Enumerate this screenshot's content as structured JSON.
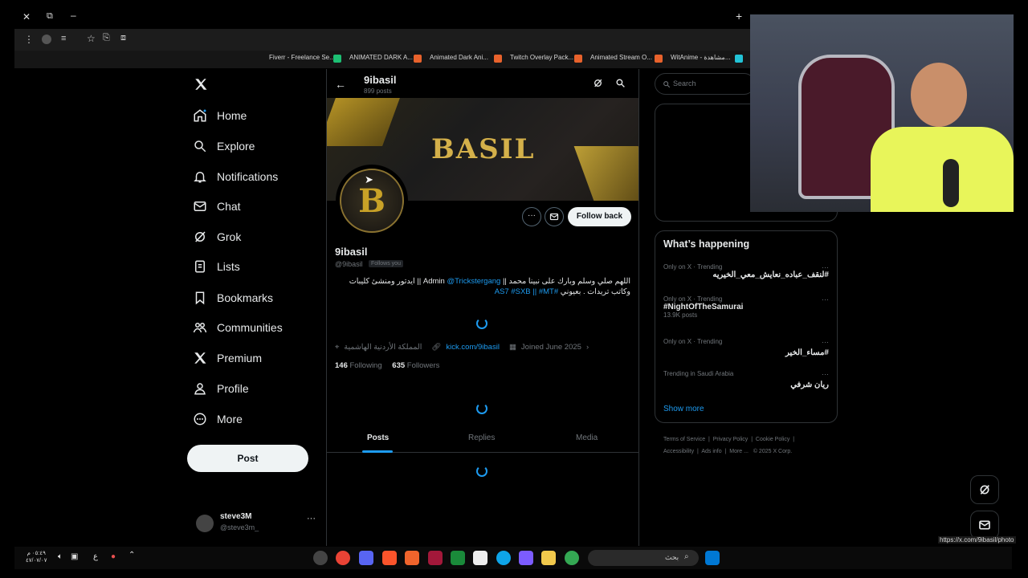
{
  "browser": {
    "bookmarks": [
      {
        "label": "Fiverr - Freelance Se...",
        "color": "#1dbf73"
      },
      {
        "label": "ANIMATED DARK A...",
        "color": "#e8622c"
      },
      {
        "label": "Animated Dark Ani...",
        "color": "#e8622c"
      },
      {
        "label": "Twitch Overlay Pack...",
        "color": "#e8622c"
      },
      {
        "label": "Animated Stream O...",
        "color": "#e8622c"
      },
      {
        "label": "WitAnime - مشاهدة...",
        "color": "#22c3d6"
      }
    ],
    "status_url": "https://x.com/9ibasil/photo"
  },
  "sidebar": {
    "items": [
      {
        "label": "Home",
        "icon": "home-icon"
      },
      {
        "label": "Explore",
        "icon": "search-icon"
      },
      {
        "label": "Notifications",
        "icon": "bell-icon"
      },
      {
        "label": "Chat",
        "icon": "mail-icon"
      },
      {
        "label": "Grok",
        "icon": "grok-icon"
      },
      {
        "label": "Lists",
        "icon": "list-icon"
      },
      {
        "label": "Bookmarks",
        "icon": "bookmark-icon"
      },
      {
        "label": "Communities",
        "icon": "people-icon"
      },
      {
        "label": "Premium",
        "icon": "x-logo-icon"
      },
      {
        "label": "Profile",
        "icon": "person-icon"
      },
      {
        "label": "More",
        "icon": "more-circle-icon"
      }
    ],
    "post_label": "Post",
    "account": {
      "name": "steve3M",
      "handle": "@steve3m_"
    }
  },
  "profile": {
    "header_name": "9ibasil",
    "post_count": "899 posts",
    "banner_text": "BASIL",
    "name": "9ibasil",
    "handle": "@9ibasil",
    "follows_you": "Follows you",
    "follow_back": "Follow back",
    "bio_line1_ar": "اللهم صلي وسلم وبارك على نبينا محمد ||",
    "bio_admin": "Admin",
    "bio_mention": "@Trickstergang",
    "bio_line1_rest": "|| ايدتور ومنشئ كليبات",
    "bio_line2_ar": "وكاتب تريدات . بعيوني",
    "bio_tags": "#AS7 #SXB || #MT",
    "location": "المملكة الأردنية الهاشمية",
    "website": "kick.com/9ibasil",
    "joined": "Joined June 2025",
    "following_count": "146",
    "following_label": "Following",
    "followers_count": "635",
    "followers_label": "Followers",
    "tabs": [
      "Posts",
      "Replies",
      "Media"
    ]
  },
  "right": {
    "search_placeholder": "Search",
    "whats_happening": "What’s happening",
    "trends": [
      {
        "meta": "Only on X · Trending",
        "name": "#لنقف_عباده_نعايش_معي_الخيريه",
        "count": ""
      },
      {
        "meta": "Only on X · Trending",
        "name": "#NightOfTheSamurai",
        "count": "13.9K posts"
      },
      {
        "meta": "Only on X · Trending",
        "name": "#مساء_الخير",
        "count": ""
      },
      {
        "meta": "Trending in Saudi Arabia",
        "name": "ريان شرفي",
        "count": ""
      }
    ],
    "show_more": "Show more",
    "footer": [
      "Terms of Service",
      "Privacy Policy",
      "Cookie Policy",
      "Accessibility",
      "Ads info",
      "More ...",
      "© 2025 X Corp."
    ]
  },
  "taskbar": {
    "time": "٠٥:٤٩ م",
    "date": "٤٧/٠٧/٠٧",
    "search_label": "بحث"
  }
}
